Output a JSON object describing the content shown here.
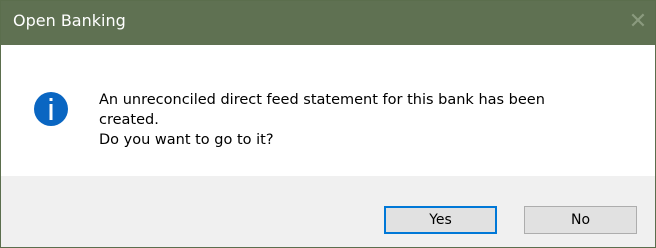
{
  "window": {
    "title": "Open Banking",
    "close_glyph": "✕"
  },
  "dialog": {
    "icon": "info-icon",
    "message_line1": "An unreconciled direct feed statement for this bank has been",
    "message_line2": "created.",
    "message_line3": "Do you want to go to it?"
  },
  "buttons": {
    "yes_label": "Yes",
    "no_label": "No"
  },
  "colors": {
    "titlebar": "#5f7152",
    "info_icon": "#0a66c2",
    "default_button_border": "#0078d7"
  }
}
